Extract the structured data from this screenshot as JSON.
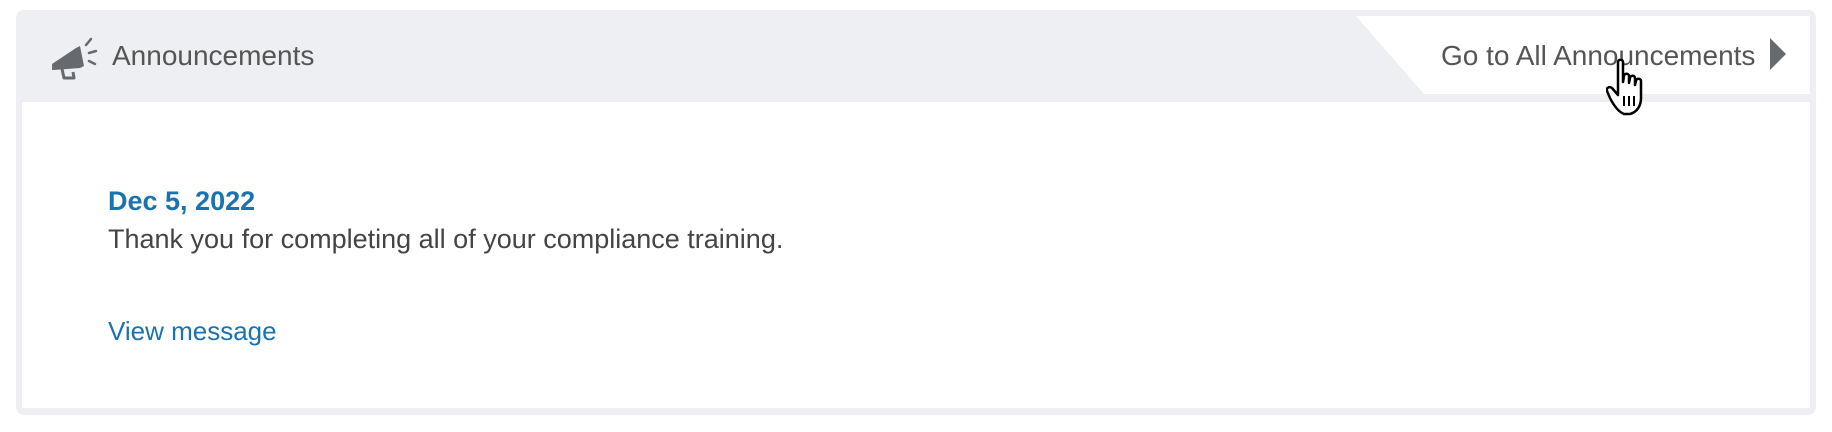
{
  "header": {
    "title": "Announcements",
    "icon": "megaphone-icon",
    "goto_label": "Go to All Announcements",
    "goto_icon": "chevron-right-icon"
  },
  "announcement": {
    "date": "Dec 5, 2022",
    "message": "Thank you for completing all of your compliance training.",
    "view_label": "View message"
  },
  "cursor": {
    "icon": "hand-pointer-icon"
  },
  "colors": {
    "link": "#1a73b0",
    "header_bg": "#eeeff2",
    "text": "#555555"
  }
}
